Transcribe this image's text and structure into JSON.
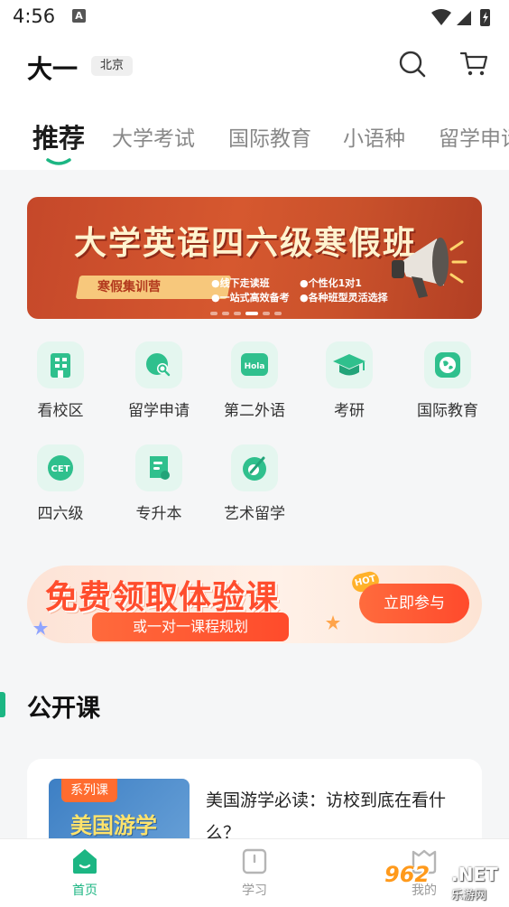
{
  "status_bar": {
    "time": "4:56",
    "notification_letter": "A"
  },
  "header": {
    "city": "大一",
    "location_tag": "北京"
  },
  "tabs": [
    {
      "label": "推荐",
      "active": true
    },
    {
      "label": "大学考试",
      "active": false
    },
    {
      "label": "国际教育",
      "active": false
    },
    {
      "label": "小语种",
      "active": false
    },
    {
      "label": "留学申请",
      "active": false
    }
  ],
  "banner": {
    "title": "大学英语四六级寒假班",
    "pill": "寒假集训营",
    "features": [
      "●线下走读班",
      "●个性化1对1",
      "●一站式高效备考",
      "●各种班型灵活选择"
    ],
    "active_dot": 3,
    "dot_count": 6
  },
  "categories": [
    {
      "label": "看校区",
      "icon": "building-icon"
    },
    {
      "label": "留学申请",
      "icon": "globe-search-icon"
    },
    {
      "label": "第二外语",
      "icon": "hola-icon",
      "icon_text": "Hola"
    },
    {
      "label": "考研",
      "icon": "graduation-cap-icon"
    },
    {
      "label": "国际教育",
      "icon": "earth-icon"
    },
    {
      "label": "四六级",
      "icon": "cet-icon",
      "icon_text": "CET"
    },
    {
      "label": "专升本",
      "icon": "certificate-icon"
    },
    {
      "label": "艺术留学",
      "icon": "palette-icon"
    }
  ],
  "promo": {
    "title": "免费领取体验课",
    "subtitle": "或一对一课程规划",
    "hot": "HOT",
    "button": "立即参与"
  },
  "section": {
    "title": "公开课"
  },
  "course": {
    "tag": "系列课",
    "thumb_text": "美国游学",
    "title": "美国游学必读：访校到底在看什么？"
  },
  "bottom_nav": [
    {
      "label": "首页",
      "active": true,
      "icon": "home-icon"
    },
    {
      "label": "学习",
      "active": false,
      "icon": "book-icon"
    },
    {
      "label": "我的",
      "active": false,
      "icon": "profile-icon"
    }
  ],
  "colors": {
    "accent": "#1cb683",
    "banner": "#c9512b",
    "promo": "#ff4d2d"
  }
}
